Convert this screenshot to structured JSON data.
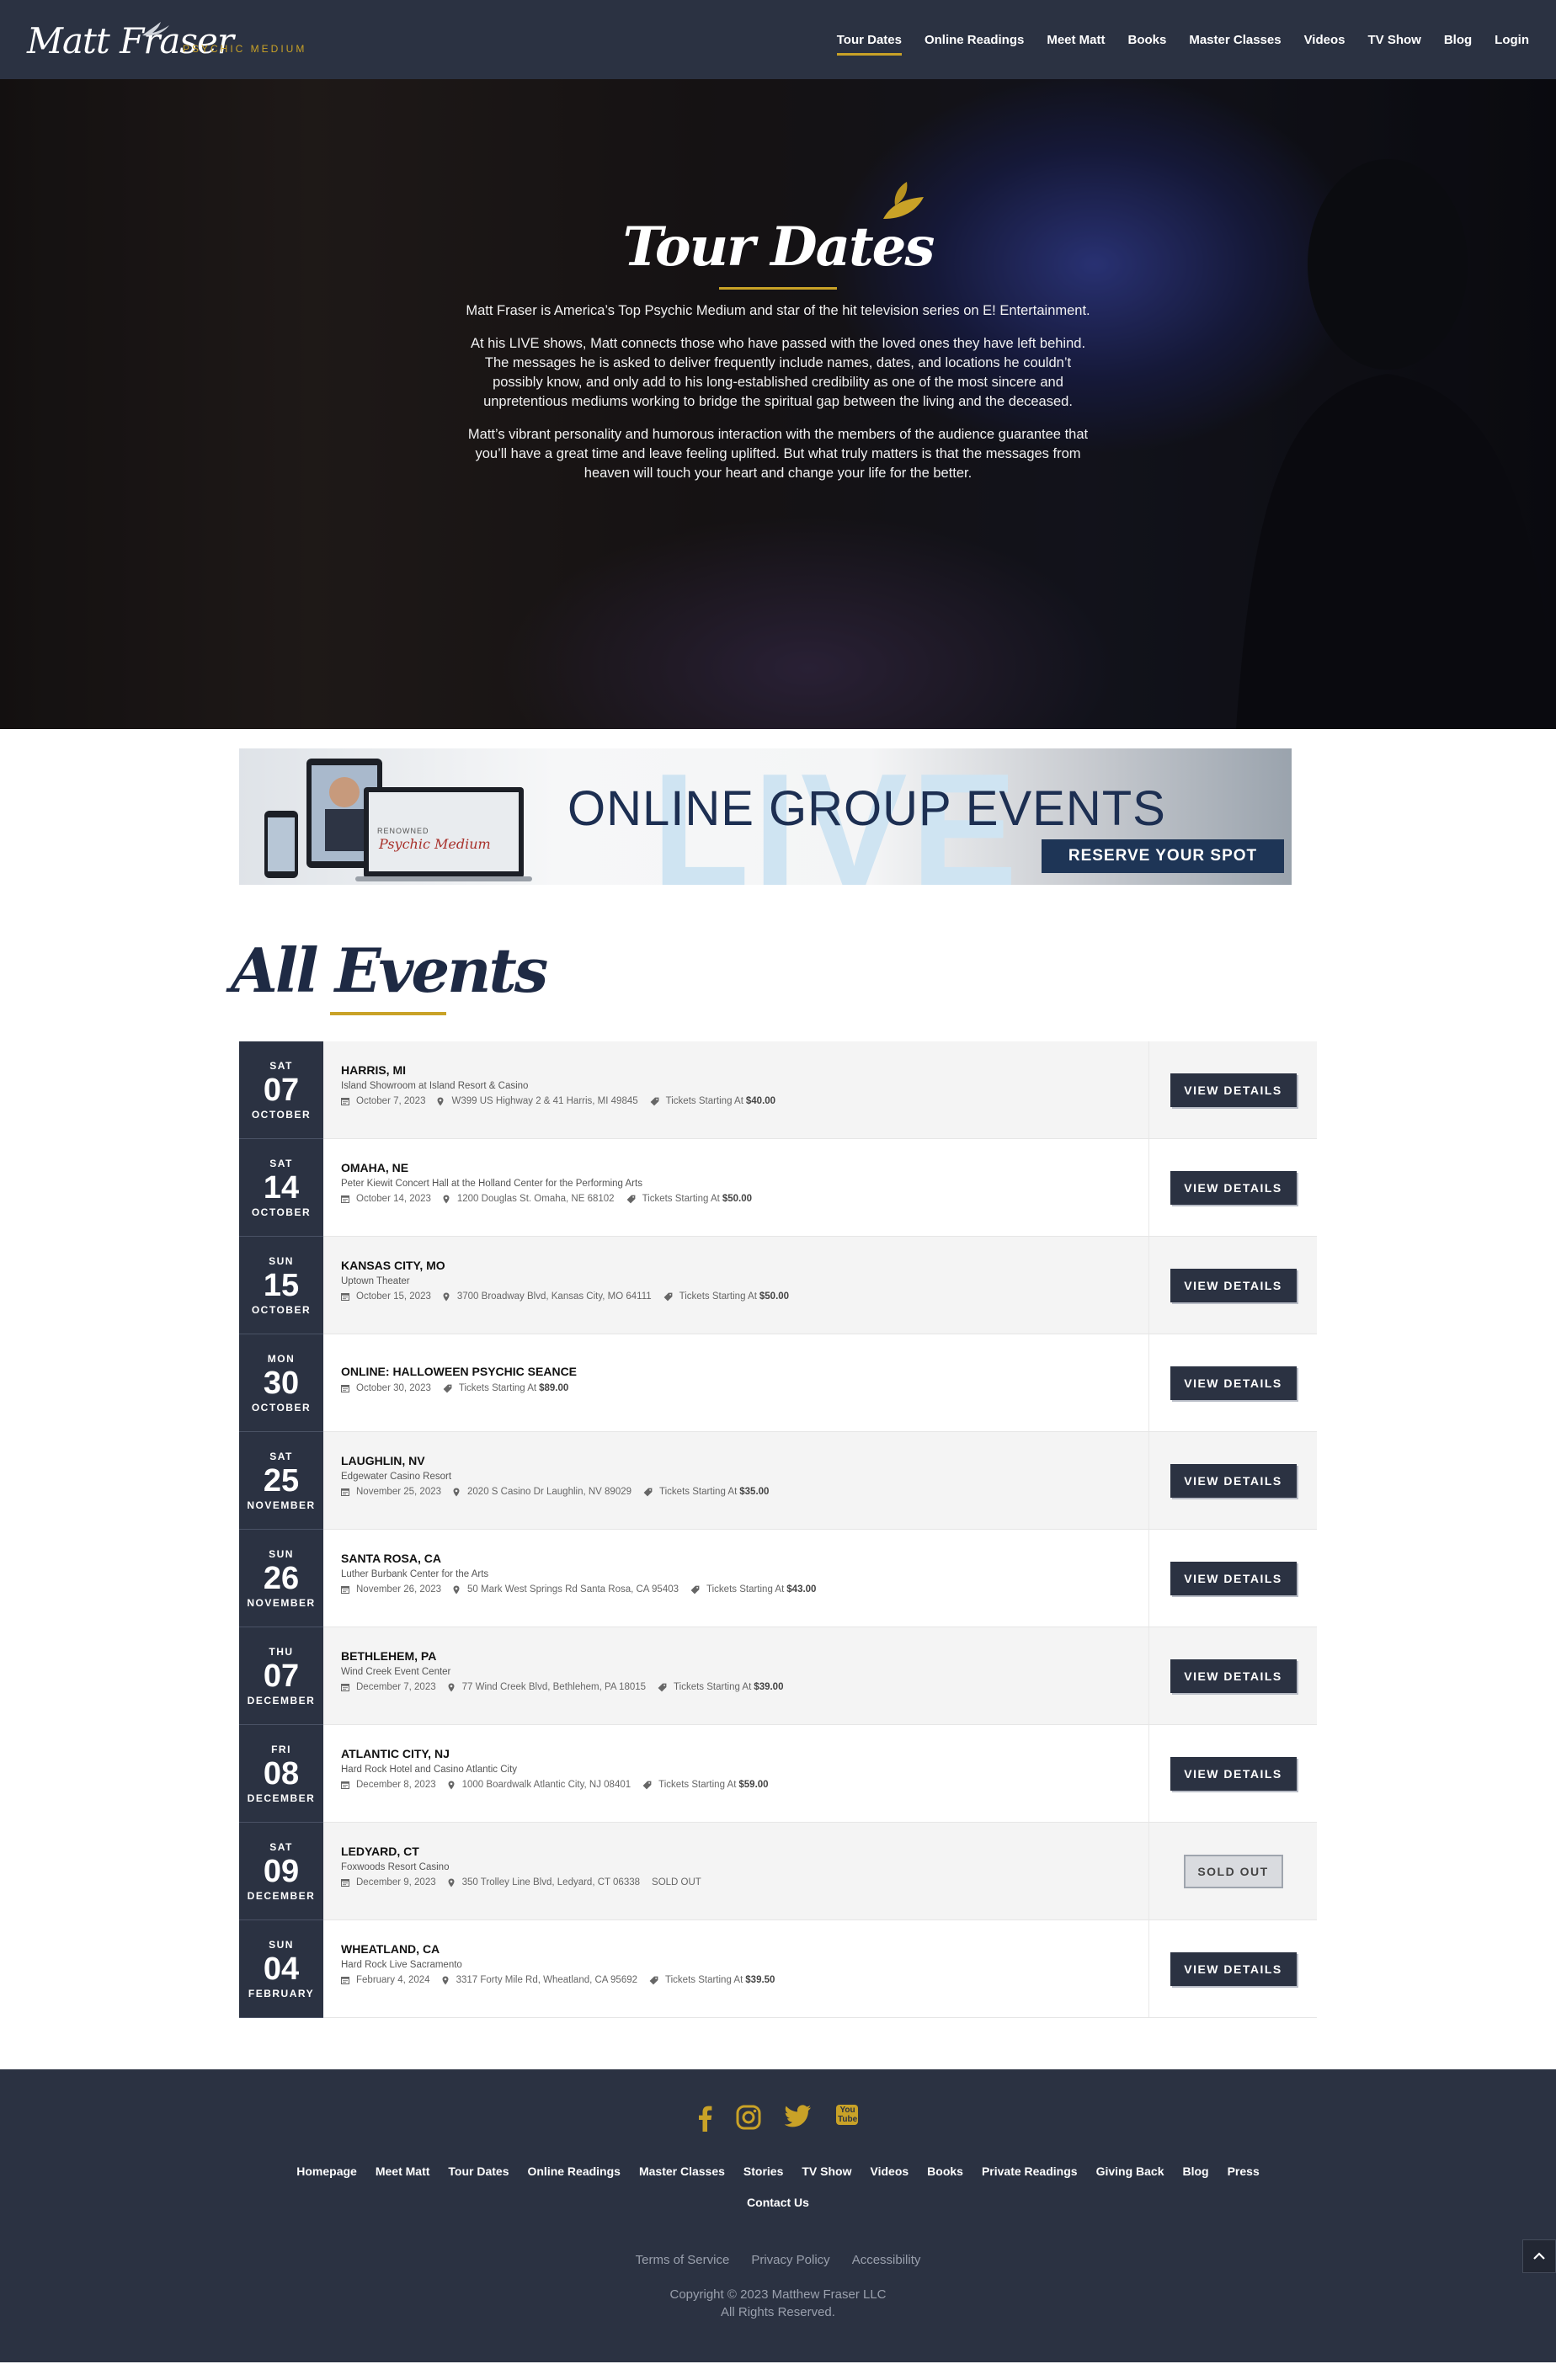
{
  "header": {
    "logo_script": "Matt Fraser",
    "logo_sub": "PSYCHIC MEDIUM",
    "nav": [
      "Tour Dates",
      "Online Readings",
      "Meet Matt",
      "Books",
      "Master Classes",
      "Videos",
      "TV Show",
      "Blog",
      "Login"
    ],
    "active_nav": "Tour Dates"
  },
  "hero": {
    "title": "Tour Dates",
    "paragraphs": [
      "Matt Fraser is America’s Top Psychic Medium and star of the hit television series on E! Entertainment.",
      "At his LIVE shows, Matt connects those who have passed with the loved ones they have left behind. The messages he is asked to deliver frequently include names, dates, and locations he couldn’t possibly know, and only add to his long-established credibility as one of the most sincere and unpretentious mediums working to bridge the spiritual gap between the living and the deceased.",
      "Matt’s vibrant personality and humorous interaction with the members of the audience guarantee that you’ll have a great time and leave feeling uplifted. But what truly matters is that the messages from heaven will touch your heart and change your life for the better."
    ]
  },
  "banner": {
    "live_word": "LIVE",
    "headline": "ONLINE GROUP EVENTS",
    "cta": "RESERVE YOUR SPOT",
    "screen_line1": "RENOWNED",
    "screen_line2": "Psychic Medium"
  },
  "events_section": {
    "title": "All Events",
    "details_label": "VIEW DETAILS",
    "sold_out_label": "SOLD OUT",
    "price_prefix": "Tickets Starting At"
  },
  "events": [
    {
      "dow": "SAT",
      "day": "07",
      "month": "OCTOBER",
      "city": "HARRIS, MI",
      "venue": "Island Showroom at Island Resort & Casino",
      "date": "October 7, 2023",
      "address": "W399 US Highway 2 & 41 Harris, MI 49845",
      "price": "$40.00",
      "status": "available"
    },
    {
      "dow": "SAT",
      "day": "14",
      "month": "OCTOBER",
      "city": "OMAHA, NE",
      "venue": "Peter Kiewit Concert Hall at the Holland Center for the Performing Arts",
      "date": "October 14, 2023",
      "address": "1200 Douglas St. Omaha, NE 68102",
      "price": "$50.00",
      "status": "available"
    },
    {
      "dow": "SUN",
      "day": "15",
      "month": "OCTOBER",
      "city": "KANSAS CITY, MO",
      "venue": "Uptown Theater",
      "date": "October 15, 2023",
      "address": "3700 Broadway Blvd, Kansas City, MO 64111",
      "price": "$50.00",
      "status": "available"
    },
    {
      "dow": "MON",
      "day": "30",
      "month": "OCTOBER",
      "city": "ONLINE: HALLOWEEN PSYCHIC SEANCE",
      "venue": "",
      "date": "October 30, 2023",
      "address": "",
      "price": "$89.00",
      "status": "available"
    },
    {
      "dow": "SAT",
      "day": "25",
      "month": "NOVEMBER",
      "city": "LAUGHLIN, NV",
      "venue": "Edgewater Casino Resort",
      "date": "November 25, 2023",
      "address": "2020 S Casino Dr Laughlin, NV 89029",
      "price": "$35.00",
      "status": "available"
    },
    {
      "dow": "SUN",
      "day": "26",
      "month": "NOVEMBER",
      "city": "SANTA ROSA, CA",
      "venue": "Luther Burbank Center for the Arts",
      "date": "November 26, 2023",
      "address": "50 Mark West Springs Rd Santa Rosa, CA 95403",
      "price": "$43.00",
      "status": "available"
    },
    {
      "dow": "THU",
      "day": "07",
      "month": "DECEMBER",
      "city": "BETHLEHEM, PA",
      "venue": "Wind Creek Event Center",
      "date": "December 7, 2023",
      "address": "77 Wind Creek Blvd, Bethlehem, PA 18015",
      "price": "$39.00",
      "status": "available"
    },
    {
      "dow": "FRI",
      "day": "08",
      "month": "DECEMBER",
      "city": "ATLANTIC CITY, NJ",
      "venue": "Hard Rock Hotel and Casino Atlantic City",
      "date": "December 8, 2023",
      "address": "1000 Boardwalk Atlantic City, NJ 08401",
      "price": "$59.00",
      "status": "available"
    },
    {
      "dow": "SAT",
      "day": "09",
      "month": "DECEMBER",
      "city": "LEDYARD, CT",
      "venue": "Foxwoods Resort Casino",
      "date": "December 9, 2023",
      "address": "350 Trolley Line Blvd, Ledyard, CT 06338",
      "price": "",
      "status": "sold_out",
      "meta_note": "SOLD OUT"
    },
    {
      "dow": "SUN",
      "day": "04",
      "month": "FEBRUARY",
      "city": "WHEATLAND, CA",
      "venue": "Hard Rock Live Sacramento",
      "date": "February 4, 2024",
      "address": "3317 Forty Mile Rd, Wheatland, CA 95692",
      "price": "$39.50",
      "status": "available"
    }
  ],
  "footer": {
    "social": [
      "facebook-icon",
      "instagram-icon",
      "twitter-icon",
      "youtube-icon"
    ],
    "youtube_text": "You Tube",
    "links": [
      "Homepage",
      "Meet Matt",
      "Tour Dates",
      "Online Readings",
      "Master Classes",
      "Stories",
      "TV Show",
      "Videos",
      "Books",
      "Private Readings",
      "Giving Back",
      "Blog",
      "Press"
    ],
    "contact": "Contact Us",
    "legal": [
      "Terms of Service",
      "Privacy Policy",
      "Accessibility"
    ],
    "copyright_line1": "Copyright © 2023 Matthew Fraser LLC",
    "copyright_line2": "All Rights Reserved."
  },
  "colors": {
    "navy": "#2b3242",
    "gold": "#c9a227",
    "banner_navy": "#1e3556"
  }
}
